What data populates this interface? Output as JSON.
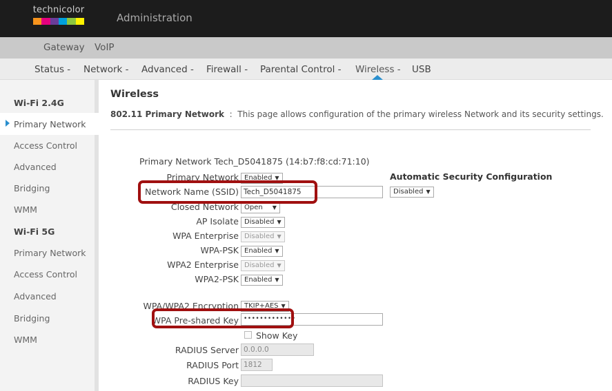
{
  "brand": {
    "logo_text": "technicolor",
    "logo_colors": [
      "#f7941d",
      "#e5007e",
      "#6a3d9a",
      "#00a0dc",
      "#8dc63f",
      "#fff200"
    ],
    "app_title": "Administration"
  },
  "main_nav": {
    "items": [
      "Gateway",
      "VoIP"
    ]
  },
  "sub_nav": {
    "items": [
      "Status -",
      "Network -",
      "Advanced -",
      "Firewall -",
      "Parental Control -",
      "Wireless -",
      "USB"
    ],
    "active": "Wireless -"
  },
  "sidebar": {
    "group1_title": "Wi-Fi 2.4G",
    "group1_items": [
      "Primary Network",
      "Access Control",
      "Advanced",
      "Bridging",
      "WMM"
    ],
    "group2_title": "Wi-Fi 5G",
    "group2_items": [
      "Primary Network",
      "Access Control",
      "Advanced",
      "Bridging",
      "WMM"
    ],
    "active_item": "Primary Network"
  },
  "page": {
    "title": "Wireless",
    "desc_bold": "802.11 Primary Network",
    "desc_text": "  :  This page allows configuration of the primary wireless Network and its security settings."
  },
  "form": {
    "section_label": "Primary Network Tech_D5041875 (14:b7:f8:cd:71:10)",
    "primary_network_label": "Primary Network",
    "primary_network_value": "Enabled",
    "ssid_label": "Network Name (SSID)",
    "ssid_value": "Tech_D5041875",
    "closed_network_label": "Closed Network",
    "closed_network_value": "Open",
    "ap_isolate_label": "AP Isolate",
    "ap_isolate_value": "Disabled",
    "wpa_enterprise_label": "WPA Enterprise",
    "wpa_enterprise_value": "Disabled",
    "wpa_psk_label": "WPA-PSK",
    "wpa_psk_value": "Enabled",
    "wpa2_enterprise_label": "WPA2 Enterprise",
    "wpa2_enterprise_value": "Disabled",
    "wpa2_psk_label": "WPA2-PSK",
    "wpa2_psk_value": "Enabled",
    "encryption_label": "WPA/WPA2 Encryption",
    "encryption_value": "TKIP+AES",
    "psk_label": "WPA Pre-shared Key",
    "psk_value": "•••••••••••••",
    "show_key_label": "Show Key",
    "radius_server_label": "RADIUS Server",
    "radius_server_value": "0.0.0.0",
    "radius_port_label": "RADIUS Port",
    "radius_port_value": "1812",
    "radius_key_label": "RADIUS Key",
    "radius_key_value": ""
  },
  "auto_security": {
    "title": "Automatic Security Configuration",
    "value": "Disabled"
  },
  "dropdown_arrow": "▼",
  "colors": {
    "accent": "#2a8fce",
    "highlight_box": "#a01010"
  }
}
